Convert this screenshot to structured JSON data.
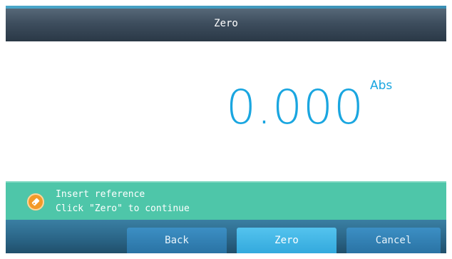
{
  "window": {
    "title": "Zero"
  },
  "reading": {
    "value": "0.000",
    "unit": "Abs"
  },
  "status": {
    "icon": "tag-icon",
    "line1": "Insert reference",
    "line2": "Click \"Zero\" to continue"
  },
  "footer": {
    "back_label": "Back",
    "zero_label": "Zero",
    "cancel_label": "Cancel"
  },
  "colors": {
    "accent": "#1aa6e0",
    "status_bar": "#4ec6a9",
    "status_icon": "#f39a28",
    "title_bar": "#3d4d5d",
    "button": "#2a73a4",
    "primary_button": "#33a9dd"
  }
}
